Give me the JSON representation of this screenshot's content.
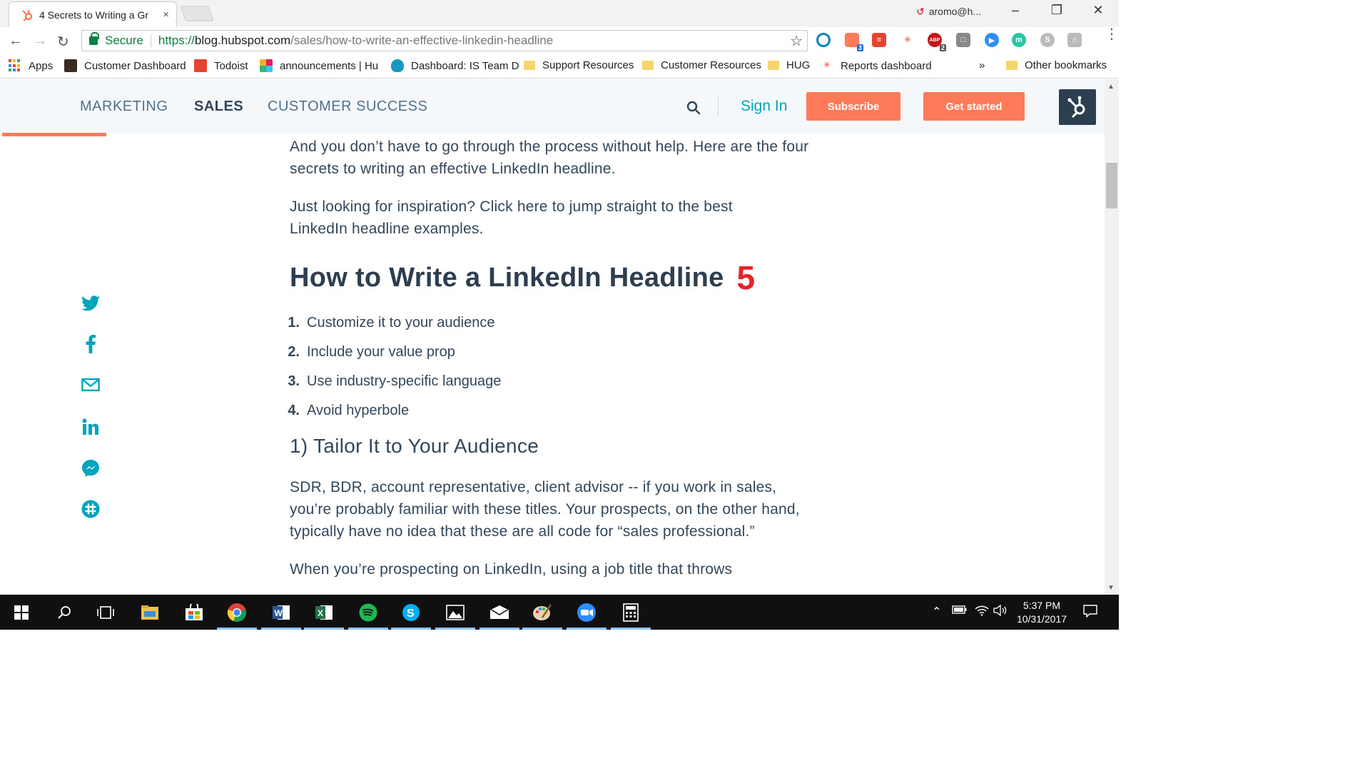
{
  "browser": {
    "tab_title": "4 Secrets to Writing a Gr",
    "tab_close": "×",
    "profile_name": "aromo@h...",
    "url_proto": "https://",
    "url_host": "blog.hubspot.com",
    "url_path": "/sales/how-to-write-an-effective-linkedin-headline",
    "secure_label": "Secure",
    "extension_badges": {
      "hubspot_ext": "3",
      "adblock": "2"
    },
    "bookmarks": {
      "apps": "Apps",
      "customer_dashboard": "Customer Dashboard",
      "todoist": "Todoist",
      "announcements": "announcements | Hu",
      "dashboard_is": "Dashboard: IS Team D",
      "support_resources": "Support Resources",
      "customer_resources": "Customer Resources",
      "hug": "HUG",
      "reports_dashboard": "Reports dashboard",
      "overflow": "»",
      "other_bookmarks": "Other bookmarks"
    }
  },
  "site_nav": {
    "marketing": "MARKETING",
    "sales": "SALES",
    "customer_success": "CUSTOMER SUCCESS",
    "sign_in": "Sign In",
    "subscribe": "Subscribe",
    "get_started": "Get started"
  },
  "article": {
    "intro_1": "And you don’t have to go through the process without help. Here are the four secrets to writing an effective LinkedIn headline.",
    "intro_2": "Just looking for inspiration? Click here to jump straight to the best LinkedIn headline examples.",
    "heading": "How to Write a LinkedIn Headline",
    "heading_badge": "5",
    "steps": [
      {
        "num": "1.",
        "text": "Customize it to your audience"
      },
      {
        "num": "2.",
        "text": "Include your value prop"
      },
      {
        "num": "3.",
        "text": "Use industry-specific language"
      },
      {
        "num": "4.",
        "text": "Avoid hyperbole"
      }
    ],
    "subheading": "1) Tailor It to Your Audience",
    "body_1": "SDR, BDR, account representative, client advisor -- if you work in sales, you’re probably familiar with these titles. Your prospects, on the other hand, typically have no idea that these are all code for “sales professional.”",
    "body_2_partial": "When you’re prospecting on LinkedIn, using a job title that throws"
  },
  "share_icons": [
    "twitter-icon",
    "facebook-icon",
    "email-icon",
    "linkedin-icon",
    "messenger-icon",
    "slack-icon"
  ],
  "taskbar": {
    "time": "5:37 PM",
    "date": "10/31/2017"
  },
  "colors": {
    "accent_orange": "#ff7a59",
    "link_teal": "#00a4bd",
    "heading_navy": "#2d3e50",
    "badge_red": "#e8222a",
    "secure_green": "#0b8043"
  }
}
